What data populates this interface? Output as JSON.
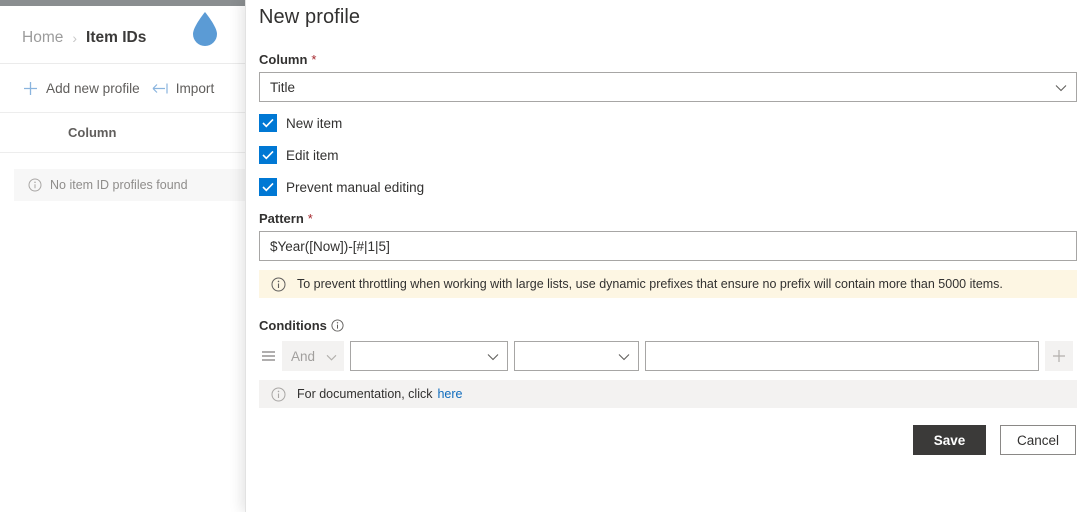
{
  "app": {
    "top_bar_color": "#8a8e90",
    "accent_color": "#0078d4",
    "logo_icon": "water-drop-icon"
  },
  "breadcrumb": {
    "home_label": "Home",
    "separator": "›",
    "current_label": "Item IDs"
  },
  "commandbar": {
    "items": [
      {
        "label": "Add new profile",
        "icon": "plus-icon"
      },
      {
        "label": "Import",
        "icon": "import-arrow-icon"
      }
    ]
  },
  "list": {
    "columns": [
      "Column"
    ],
    "empty_message": "No item ID profiles found",
    "empty_icon": "info-icon"
  },
  "panel": {
    "title": "New profile",
    "column_field": {
      "label": "Column",
      "required_marker": "*",
      "value": "Title",
      "chevron_icon": "chevron-down-icon"
    },
    "checkboxes": [
      {
        "label": "New item",
        "checked": true
      },
      {
        "label": "Edit item",
        "checked": true
      },
      {
        "label": "Prevent manual editing",
        "checked": true
      }
    ],
    "pattern_field": {
      "label": "Pattern",
      "required_marker": "*",
      "value": "$Year([Now])-[#|1|5]"
    },
    "warning": {
      "icon": "info-icon",
      "text": "To prevent throttling when working with large lists, use dynamic prefixes that ensure no prefix will contain more than 5000 items.",
      "background": "#fdf6e3"
    },
    "conditions": {
      "label": "Conditions",
      "info_icon": "info-circle-icon",
      "row": {
        "drag_handle_icon": "drag-handle-icon",
        "operator_value": "And",
        "operator_disabled": true,
        "field_value": "",
        "comparison_value": "",
        "criteria_value": "",
        "add_label": "+"
      }
    },
    "documentation": {
      "icon": "info-icon",
      "text": "For documentation, click",
      "link_label": "here",
      "background": "#f3f2f1"
    },
    "buttons": {
      "save_label": "Save",
      "cancel_label": "Cancel",
      "save_color": "#3b3a39"
    }
  }
}
